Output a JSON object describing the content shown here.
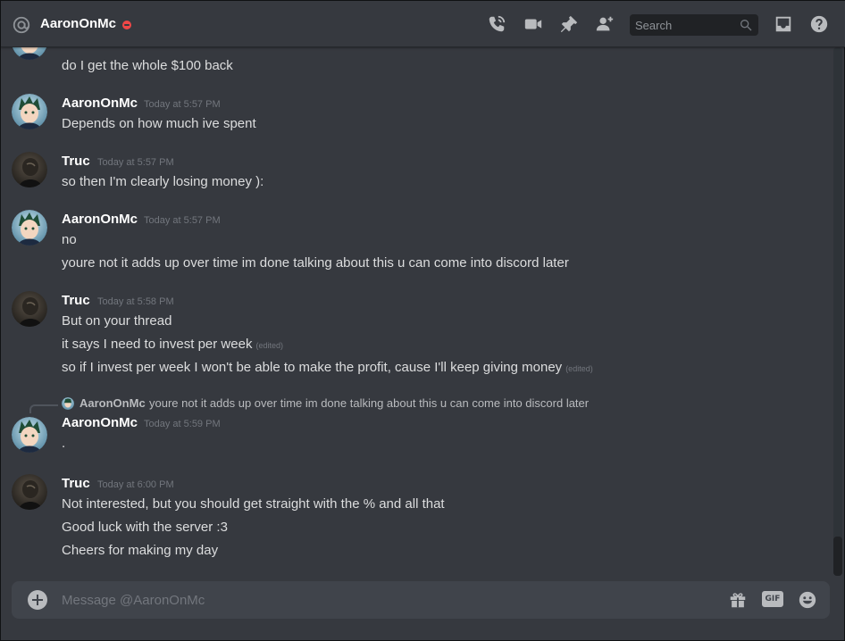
{
  "header": {
    "channel_name": "AaronOnMc",
    "status": "dnd",
    "search_placeholder": "Search",
    "icons": [
      "at-icon",
      "start-voice-call-icon",
      "start-video-call-icon",
      "pinned-messages-icon",
      "add-friend-icon",
      "search-icon",
      "inbox-icon",
      "help-icon"
    ]
  },
  "messages": [
    {
      "type": "continuation",
      "lines": [
        {
          "text": "do I get the whole $100 back"
        }
      ]
    },
    {
      "author": "AaronOnMc",
      "timestamp": "Today at 5:57 PM",
      "avatar": "anime-boy-green-hair",
      "lines": [
        {
          "text": "Depends on how much ive spent"
        }
      ]
    },
    {
      "author": "Truc",
      "timestamp": "Today at 5:57 PM",
      "avatar": "dark-statue",
      "lines": [
        {
          "text": "so then I'm clearly losing money ):"
        }
      ]
    },
    {
      "author": "AaronOnMc",
      "timestamp": "Today at 5:57 PM",
      "avatar": "anime-boy-green-hair",
      "lines": [
        {
          "text": "no"
        },
        {
          "text": "youre not it adds up over time im done talking about this u can come into discord later"
        }
      ]
    },
    {
      "author": "Truc",
      "timestamp": "Today at 5:58 PM",
      "avatar": "dark-statue",
      "lines": [
        {
          "text": "But on your thread"
        },
        {
          "text": "it says I need to invest per week",
          "edited": "(edited)"
        },
        {
          "text": "so if I invest per week I won't be able to make the profit, cause I'll keep giving money",
          "edited": "(edited)"
        }
      ]
    },
    {
      "author": "AaronOnMc",
      "timestamp": "Today at 5:59 PM",
      "avatar": "anime-boy-green-hair",
      "reply": {
        "author": "AaronOnMc",
        "text": "youre not it adds up over time im done talking about this u can come into discord later"
      },
      "lines": [
        {
          "text": "."
        }
      ]
    },
    {
      "author": "Truc",
      "timestamp": "Today at 6:00 PM",
      "avatar": "dark-statue",
      "lines": [
        {
          "text": "Not interested, but you should get straight with the % and all that"
        },
        {
          "text": "Good luck with the server :3"
        },
        {
          "text": "Cheers for making my day"
        }
      ]
    }
  ],
  "composer": {
    "placeholder": "Message @AaronOnMc",
    "gif_label": "GIF",
    "icons": [
      "add-attachment-icon",
      "gift-icon",
      "emoji-icon"
    ]
  },
  "colors": {
    "background": "#36393f",
    "composer": "#40444b",
    "username": "#ffffff",
    "text": "#dcddde",
    "muted": "#72767d",
    "dnd": "#f04747"
  }
}
